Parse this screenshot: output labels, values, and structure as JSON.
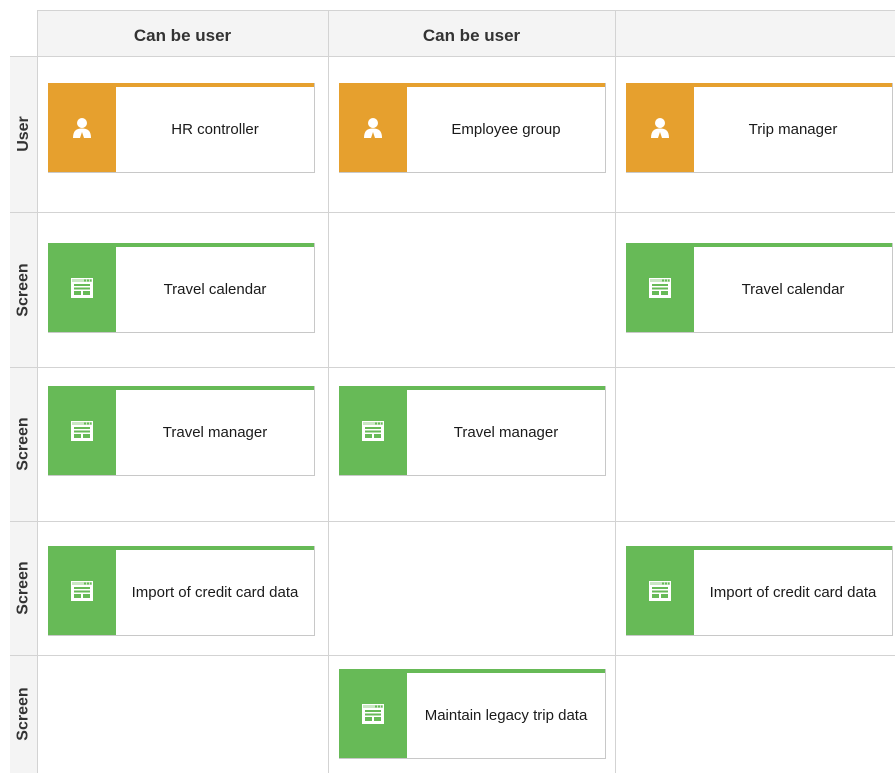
{
  "columns": [
    {
      "label": "Can be user"
    },
    {
      "label": "Can be user"
    },
    {
      "label": ""
    }
  ],
  "rows": [
    {
      "label": "User"
    },
    {
      "label": "Screen"
    },
    {
      "label": "Screen"
    },
    {
      "label": "Screen"
    },
    {
      "label": "Screen"
    }
  ],
  "colors": {
    "user": "#e6a02e",
    "screen": "#67ba57"
  },
  "cards": [
    {
      "row": 0,
      "col": 0,
      "kind": "user",
      "icon": "person-icon",
      "label": "HR controller"
    },
    {
      "row": 0,
      "col": 1,
      "kind": "user",
      "icon": "person-icon",
      "label": "Employee group"
    },
    {
      "row": 0,
      "col": 2,
      "kind": "user",
      "icon": "person-icon",
      "label": "Trip manager"
    },
    {
      "row": 1,
      "col": 0,
      "kind": "screen",
      "icon": "screen-icon",
      "label": "Travel calendar"
    },
    {
      "row": 1,
      "col": 2,
      "kind": "screen",
      "icon": "screen-icon",
      "label": "Travel calendar"
    },
    {
      "row": 2,
      "col": 0,
      "kind": "screen",
      "icon": "screen-icon",
      "label": "Travel manager"
    },
    {
      "row": 2,
      "col": 1,
      "kind": "screen",
      "icon": "screen-icon",
      "label": "Travel manager"
    },
    {
      "row": 3,
      "col": 0,
      "kind": "screen",
      "icon": "screen-icon",
      "label": "Import of credit card data"
    },
    {
      "row": 3,
      "col": 2,
      "kind": "screen",
      "icon": "screen-icon",
      "label": "Import of credit card data"
    },
    {
      "row": 4,
      "col": 1,
      "kind": "screen",
      "icon": "screen-icon",
      "label": "Maintain legacy trip data"
    }
  ]
}
